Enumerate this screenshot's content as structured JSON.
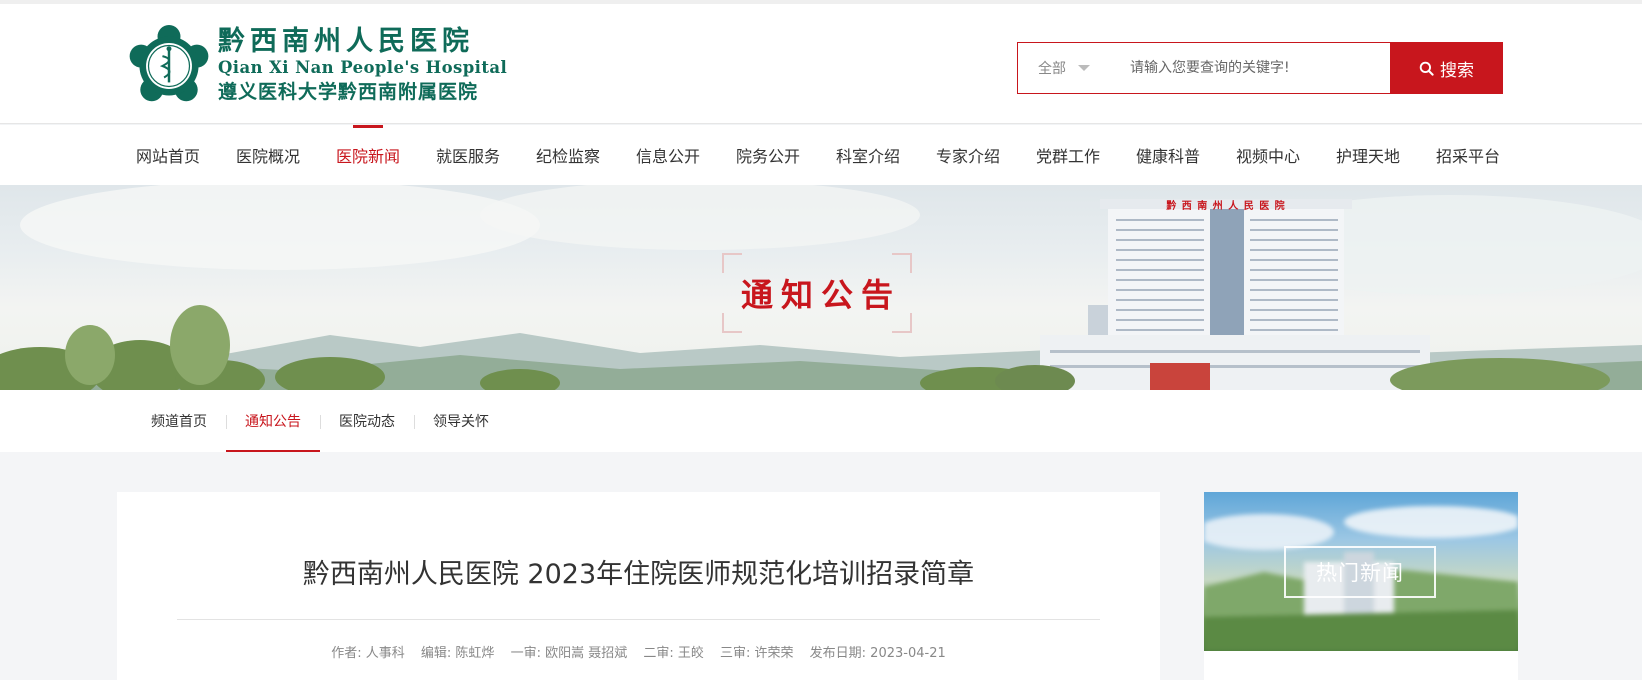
{
  "header": {
    "logo": {
      "name_cn": "黔西南州人民医院",
      "name_en": "Qian Xi Nan People's Hospital",
      "affiliation": "遵义医科大学黔西南附属医院"
    },
    "search": {
      "scope_label": "全部",
      "placeholder": "请输入您要查询的关键字!",
      "button_label": "搜索"
    }
  },
  "nav": {
    "items": [
      {
        "label": "网站首页",
        "active": false
      },
      {
        "label": "医院概况",
        "active": false
      },
      {
        "label": "医院新闻",
        "active": true
      },
      {
        "label": "就医服务",
        "active": false
      },
      {
        "label": "纪检监察",
        "active": false
      },
      {
        "label": "信息公开",
        "active": false
      },
      {
        "label": "院务公开",
        "active": false
      },
      {
        "label": "科室介绍",
        "active": false
      },
      {
        "label": "专家介绍",
        "active": false
      },
      {
        "label": "党群工作",
        "active": false
      },
      {
        "label": "健康科普",
        "active": false
      },
      {
        "label": "视频中心",
        "active": false
      },
      {
        "label": "护理天地",
        "active": false
      },
      {
        "label": "招采平台",
        "active": false
      }
    ]
  },
  "banner": {
    "title": "通知公告",
    "building_sign": "黔 西 南 州 人 民 医 院"
  },
  "subnav": {
    "items": [
      {
        "label": "频道首页",
        "active": false
      },
      {
        "label": "通知公告",
        "active": true
      },
      {
        "label": "医院动态",
        "active": false
      },
      {
        "label": "领导关怀",
        "active": false
      }
    ]
  },
  "article": {
    "title": "黔西南州人民医院 2023年住院医师规范化培训招录简章",
    "meta": {
      "author": "作者: 人事科",
      "editor": "编辑: 陈虹烨",
      "review1": "一审: 欧阳嵩 聂招斌",
      "review2": "二审: 王皎",
      "review3": "三审: 许荣荣",
      "date": "发布日期: 2023-04-21"
    }
  },
  "sidebar": {
    "hot_news_label": "热门新闻"
  },
  "colors": {
    "brand_red": "#c8161d",
    "logo_green": "#0f6b59"
  }
}
